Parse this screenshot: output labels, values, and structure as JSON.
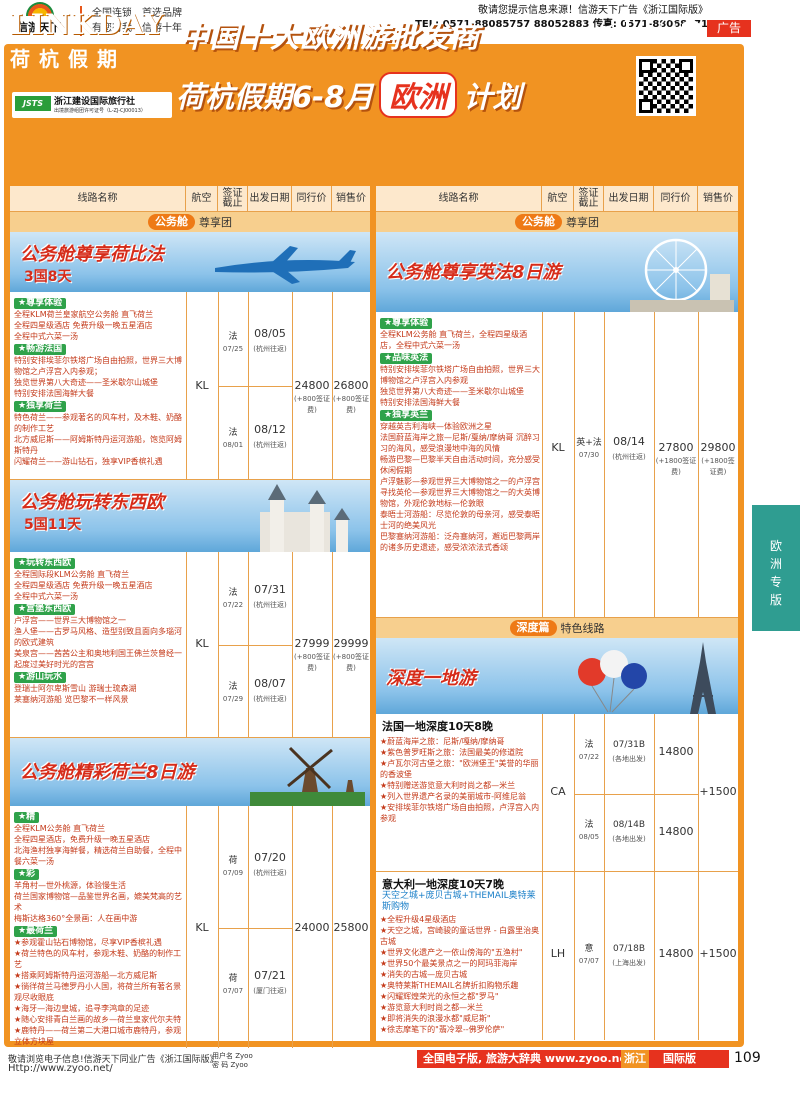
{
  "top": {
    "logo_text": "信游天下",
    "slogan1": "全国连锁",
    "slogan2": "首选品牌",
    "slogan3": "有您有我",
    "slogan4": "信游十年",
    "notice1": "敬请您提示信息来源！信游天下广告《浙江国际版》",
    "notice2": "TEL: 0571-88085757 88052883 传真: 0571-88068071",
    "ad": "广告"
  },
  "header": {
    "brand_en": "LINKDAY",
    "brand_cn": "荷杭假期",
    "jsts_mark": "JSTS",
    "jsts_name": "浙江建设国际旅行社",
    "jsts_lic": "出境旅游组团许可证号（L-ZJ-CJ00013）",
    "title1": "中国十大欧洲游批发商",
    "title2a": "荷杭假期6-8月",
    "title2b": "欧洲",
    "title2c": "计划"
  },
  "columns": [
    "线路名称",
    "航空",
    "签证截止",
    "出发日期",
    "同行价",
    "销售价"
  ],
  "left": {
    "section": {
      "pill": "公务舱",
      "text": "尊享团"
    },
    "r1": {
      "banner_t": "公务舱尊享荷比法",
      "banner_s": "3国8天",
      "tag1": "★尊享体验",
      "d1": "全程KLM荷兰皇家航空公务舱 直飞荷兰\n全程四星级酒店 免费升级一晚五星酒店\n全程中式六菜一汤",
      "tag2": "★畅游法国",
      "d2": "特别安排埃菲尔铁塔广场自由拍照，世界三大博物馆之卢浮宫入内参观；\n独览世界第八大奇迹——圣米歇尔山城堡\n特别安排法国海鲜大餐",
      "tag3": "★独享荷兰",
      "d3": "特色荷兰——参观著名的风车村，及木鞋、奶酪的制作工艺\n北方威尼斯——阿姆斯特丹运河游船，饱览阿姆斯特丹\n闪耀荷兰——游山钻石，独享VIP香槟礼遇",
      "air": "KL",
      "v1": "法",
      "v1d": "07/25",
      "v2": "法",
      "v2d": "08/01",
      "d1date": "08/05",
      "d2date": "08/12",
      "route": "(杭州往返)",
      "peer": "24800",
      "sale": "26800",
      "note": "(+800签证费)"
    },
    "r2": {
      "banner_t": "公务舱玩转东西欧",
      "banner_s": "5国11天",
      "tag1": "★玩转东西欧",
      "d1": "全程国际段KLM公务舱 直飞荷兰\n全程四星级酒店 免费升级一晚五星酒店\n全程中式六菜一汤",
      "tag2": "★宫堡东西欧",
      "d2": "卢浮宫——世界三大博物馆之一\n渔人堡——古罗马风格、造型别致且面向多瑙河的欧式建筑\n美泉宫——茜茜公主和奥地利国王佛兰茨曾经一起度过美好时光的宫宫",
      "tag3": "★游山玩水",
      "d3": "登瑞士阿尔卑斯雪山 游瑞士琉森湖\n莱塞纳河游船 览巴黎不一样风景",
      "air": "KL",
      "v1": "法",
      "v1d": "07/22",
      "v2": "法",
      "v2d": "07/29",
      "d1date": "07/31",
      "d2date": "08/07",
      "route": "(杭州往返)",
      "peer": "27999",
      "sale": "29999",
      "note": "(+800签证费)"
    },
    "r3": {
      "banner_t": "公务舱精彩荷兰8日游",
      "tag1": "★精",
      "d1": "全程KLM公务舱 直飞荷兰\n全程四星酒店，免费升级一晚五星酒店\n北海渔村独享海鲜餐，精选荷兰自助餐，全程中餐六菜一汤",
      "tag2": "★彩",
      "d2": "羊角村—世外桃源，体验慢生活\n荷兰国家博物馆—品鉴世界名画，媲美梵高的艺术\n梅斯达格360°全景画：人在画中游",
      "tag3": "★最荷兰",
      "d3": "★参观霍山钻石博物馆，尽享VIP香槟礼遇\n★荷兰特色的风车村，参观木鞋、奶酪的制作工艺\n★搭乘阿姆斯特丹运河游船—北方威尼斯\n★徜徉荷兰马德罗丹小人国，将荷兰所有著名景观尽收眼底\n★海牙—海边皇城，追寻李鸿章的足迹\n★随心安排青白兰画的故乡—荷兰皇家代尔夫特\n★鹿特丹——荷兰第二大港口城市鹿特丹，参观立体方块屋",
      "air": "KL",
      "v1": "荷",
      "v1d": "07/09",
      "v2": "荷",
      "v2d": "07/07",
      "d1date": "07/20",
      "d2date": "07/21",
      "route1": "(杭州往返)",
      "route2": "(厦门往返)",
      "peer": "24000",
      "sale": "25800"
    }
  },
  "right": {
    "section": {
      "pill": "公务舱",
      "text": "尊享团"
    },
    "r1": {
      "banner_t": "公务舱尊享英法8日游",
      "tag1": "★尊享体验",
      "d1": "全程KLM公务舱 直飞荷兰，全程四星级酒店，全程中式六菜一汤",
      "tag2": "★品味英法",
      "d2": "特别安排埃菲尔铁塔广场自由拍照，世界三大博物馆之卢浮宫入内参观\n独览世界第八大奇迹——圣米歇尔山城堡\n特别安排法国海鲜大餐",
      "tag3": "★独享英兰",
      "d3": "穿越英吉利海峡—体验欧洲之星\n法国蔚蓝海岸之旅—尼斯/戛纳/摩纳哥 沉醉习习的海风，感受浪漫地中海的风情\n畅游巴黎—巴黎半天自由活动时间，充分感受休闲假期\n卢浮魅影—参观世界三大博物馆之一的卢浮宫\n寻找英伦—参观世界三大博物馆之一的大英博物馆，外观伦敦地标—伦敦眼\n泰晤士河游船：尽览伦敦的母亲河，感受泰晤士河的绝美风光\n巴黎塞纳河游船：泛舟塞纳河，邂逅巴黎两岸的诸多历史遗迹，感受浓浓法式香颂",
      "air": "KL",
      "v1": "英+法",
      "v1d": "07/30",
      "d1date": "08/14",
      "route": "(杭州往返)",
      "peer": "27800",
      "sale": "29800",
      "note": "(+1800签证费)"
    },
    "section2": {
      "pill": "深度篇",
      "text": "特色线路"
    },
    "r2": {
      "banner_t": "深度一地游",
      "t1": "法国一地深度10天8晚",
      "d1": "★蔚蓝海岸之旅：尼斯/嘎纳/摩纳哥\n★紫色普罗旺斯之旅：法国最美的修道院\n★卢瓦尔河古堡之旅：\"欧洲堡王\"美誉的华丽的香波堡\n★特别赠送游览意大利时尚之都—米兰\n★列入世界遗产名录的美丽城市-阿维尼翁\n★安排埃菲尔铁塔广场自由拍照，卢浮宫入内参观",
      "air": "CA",
      "v1": "法",
      "v1d": "07/22",
      "v2": "法",
      "v2d": "08/05",
      "d1date": "07/31B",
      "d2date": "08/14B",
      "route1": "(各地出发)",
      "route2": "(各地出发)",
      "peer1": "14800",
      "peer2": "14800",
      "sale": "+1500",
      "t2": "意大利一地深度10天7晚",
      "sub": "天空之城+庞贝古城+THEMAIL奥特莱斯购物",
      "d2": "★全程升级4星级酒店\n★天空之城，宫崎骏的童话世界 - 白露里治奥古城\n★世界文化遗产之一依山傍海的\"五渔村\"\n★世界50个最美景点之一的阿玛菲海岸\n★消失的古城—庞贝古城\n★奥特莱斯THEMAIL名牌折扣购物乐趣\n★闪耀辉煌荣光的永恒之都\"罗马\"\n★游览意大利时尚之都—米兰\n★即将消失的浪漫水都\"威尼斯\"\n★徐志摩笔下的\"翡冷翠--佛罗伦萨\"",
      "air2": "LH",
      "v3": "意",
      "v3d": "07/07",
      "d3date": "07/18B",
      "route3": "(上海出发)",
      "peer3": "14800",
      "sale3": "+1500"
    }
  },
  "side": "欧洲专版",
  "footer": {
    "f1": "敬请浏览电子信息!信游天下同业广告《浙江国际版》",
    "f2": "Http://www.zyoo.net/",
    "user": "用户名 Zyoo\n密 码 Zyoo",
    "bar_a": "全国电子版, 旅游大辞典 www.zyoo.net",
    "bar_b": "浙江",
    "bar_c": "国际版",
    "page": "109"
  }
}
